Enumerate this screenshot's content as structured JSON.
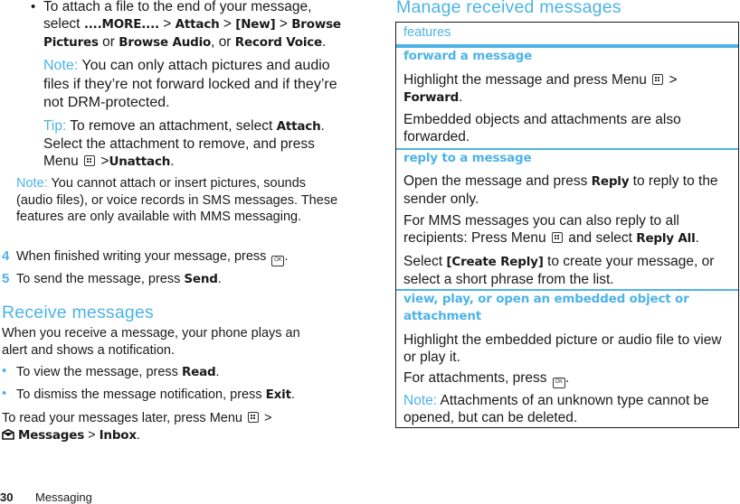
{
  "left": {
    "attach_bullet": {
      "intro": "To attach a file to the end of your message, select",
      "more": "....MORE....",
      "sep1": ">",
      "attach": "Attach",
      "sep2": ">",
      "new": "[New]",
      "sep3": ">",
      "browse_pictures": "Browse Pictures",
      "or1": "or",
      "browse_audio": "Browse Audio",
      "or2": ", or",
      "record_voice": "Record Voice",
      "end": "."
    },
    "note1": {
      "label": "Note:",
      "text": "You can only attach pictures and audio files if they’re not forward locked and if they’re not DRM-protected."
    },
    "tip": {
      "label": "Tip:",
      "text1": "To remove an attachment, select",
      "attach": "Attach",
      "text2": ". Select the attachment to remove, and press Menu",
      "sep": ">",
      "unattach": "Unattach",
      "end": "."
    },
    "note2": {
      "label": "Note:",
      "text": "You cannot attach or insert pictures, sounds (audio files), or voice records in SMS messages. These features are only available with MMS messaging."
    },
    "steps": [
      {
        "num": "4",
        "text": "When finished writing your message, press",
        "end": "."
      },
      {
        "num": "5",
        "text": "To send the message, press",
        "bold": "Send",
        "end": "."
      }
    ],
    "receive": {
      "heading": "Receive messages",
      "intro": "When you receive a message, your phone plays an alert and shows a notification.",
      "bullets": [
        {
          "text": "To view the message, press",
          "bold": "Read",
          "end": "."
        },
        {
          "text": "To dismiss the message notification, press",
          "bold": "Exit",
          "end": "."
        }
      ],
      "later_text": "To read your messages later, press Menu",
      "later_sep": ">",
      "messages": "Messages",
      "sep2": ">",
      "inbox": "Inbox",
      "end": "."
    }
  },
  "right": {
    "heading": "Manage received messages",
    "table_header": "features",
    "rows": [
      {
        "title": "forward a message",
        "p1_text": "Highlight the message and press Menu",
        "p1_sep": ">",
        "p1_bold": "Forward",
        "p1_end": ".",
        "p2": "Embedded objects and attachments are also forwarded."
      },
      {
        "title": "reply to a message",
        "p1_text1": "Open the message and press",
        "p1_bold": "Reply",
        "p1_text2": "to reply to the sender only.",
        "p2_text": "For MMS messages you can also reply to all recipients: Press Menu",
        "p2_text2": "and select",
        "p2_bold": "Reply All",
        "p2_end": ".",
        "p3_text1": "Select",
        "p3_bold": "[Create Reply]",
        "p3_text2": "to create your message, or select a short phrase from the list."
      },
      {
        "title": "view, play, or open an embedded object or attachment",
        "p1": "Highlight the embedded picture or audio file to view or play it.",
        "p2_text": "For attachments, press",
        "p2_end": ".",
        "note_label": "Note:",
        "note_text": "Attachments of an unknown type cannot be opened, but can be deleted."
      }
    ]
  },
  "footer": {
    "page_number": "30",
    "section": "Messaging"
  },
  "icons": {
    "ok_key_label": "OK"
  },
  "colors": {
    "accent": "#4db3e6",
    "text": "#1a1a1a"
  }
}
